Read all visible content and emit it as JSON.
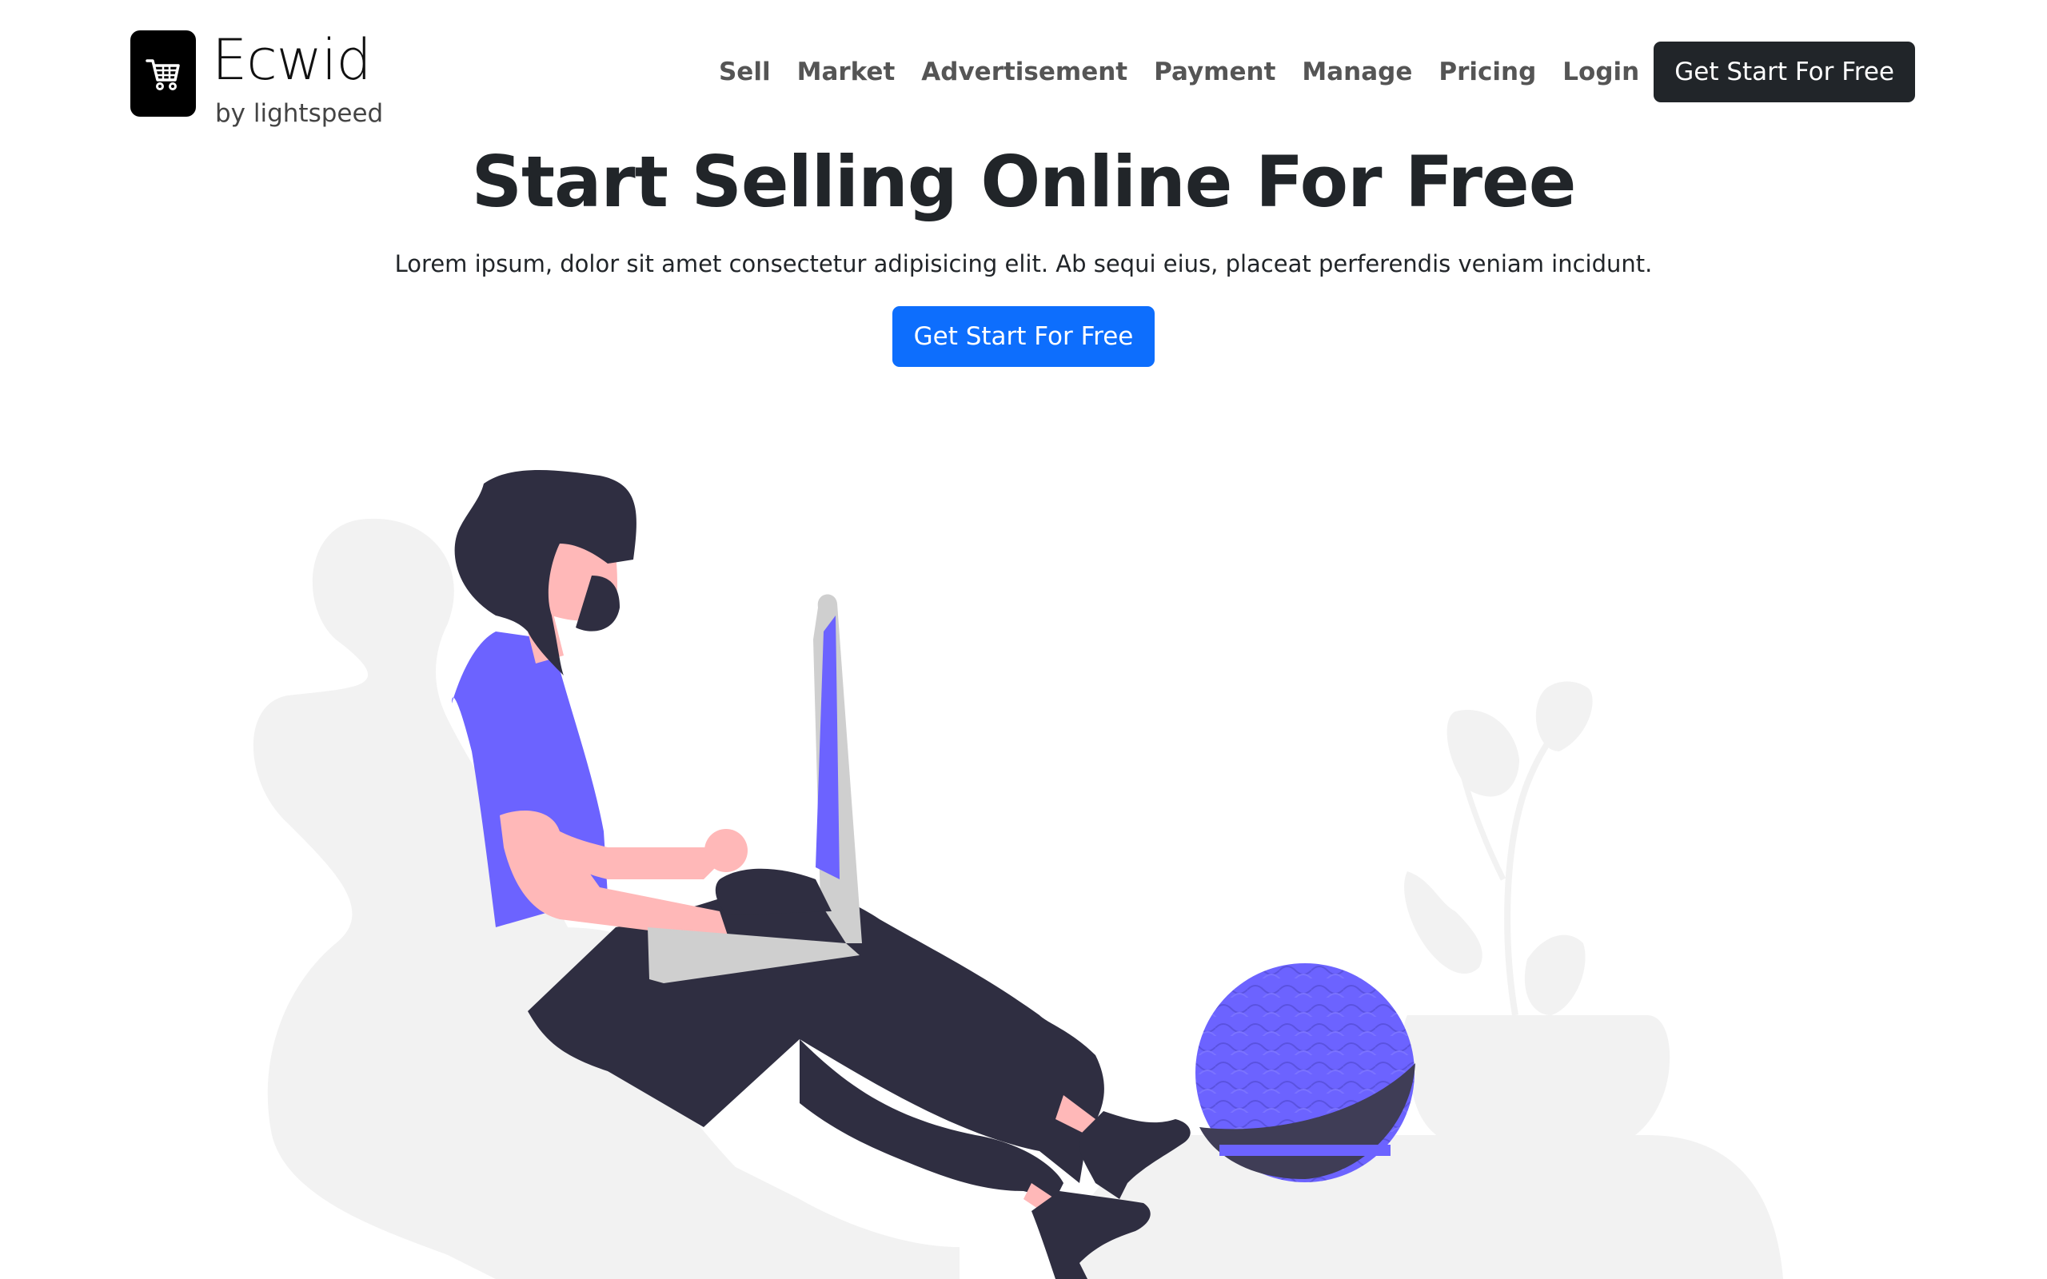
{
  "brand": {
    "name": "Ecwid",
    "tagline": "by lightspeed",
    "icon": "shopping-cart-icon"
  },
  "nav": {
    "links": [
      "Sell",
      "Market",
      "Advertisement",
      "Payment",
      "Manage",
      "Pricing",
      "Login"
    ],
    "cta": "Get Start For Free"
  },
  "hero": {
    "title": "Start Selling Online For Free",
    "subtitle": "Lorem ipsum, dolor sit amet consectetur adipisicing elit. Ab sequi eius, placeat perferendis veniam incidunt.",
    "cta": "Get Start For Free"
  },
  "colors": {
    "nav_cta_bg": "#212529",
    "hero_cta_bg": "#0d6efd",
    "accent_purple": "#6c63ff",
    "dark": "#2f2e41",
    "skin": "#ffb8b8",
    "shadow_gray": "#f2f2f2"
  }
}
